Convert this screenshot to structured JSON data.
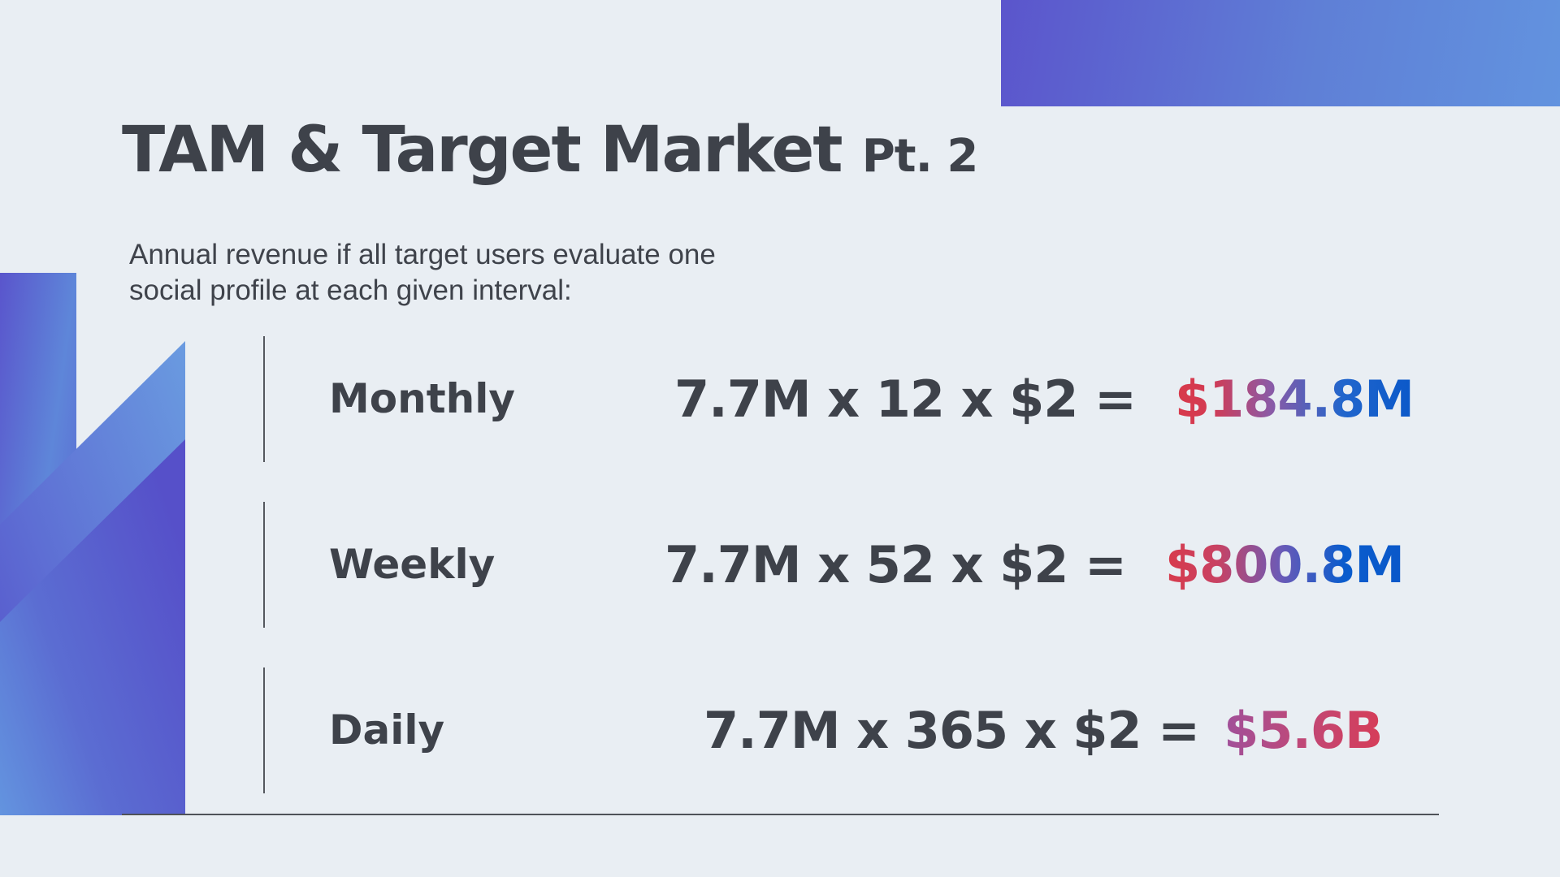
{
  "slide": {
    "title": "TAM & Target Market",
    "title_suffix": "Pt. 2",
    "subtitle": "Annual revenue if all target users evaluate one social profile at each given interval:"
  },
  "rows": [
    {
      "label": "Monthly",
      "formula": "7.7M x 12 x $2 =",
      "result": "$184.8M"
    },
    {
      "label": "Weekly",
      "formula": "7.7M x 52 x $2 =",
      "result": "$800.8M"
    },
    {
      "label": "Daily",
      "formula": "7.7M x 365 x $2 =",
      "result": "$5.6B"
    }
  ],
  "colors": {
    "background": "#e9eef3",
    "text": "#3e424a",
    "accent_purple": "#5b55cc",
    "accent_blue": "#6293df",
    "result_red": "#d83a4b",
    "result_blue": "#0a58c9"
  }
}
